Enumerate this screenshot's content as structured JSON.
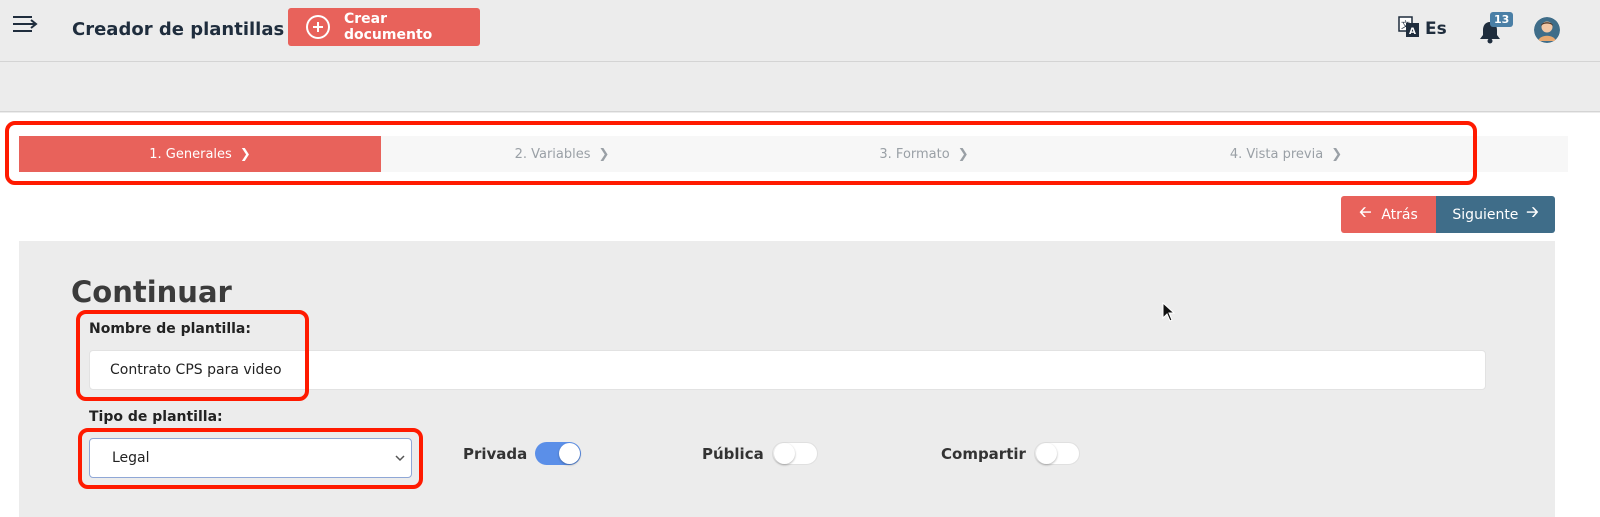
{
  "header": {
    "title": "Creador de plantillas",
    "create_button_label": "Crear documento",
    "language_label": "Es",
    "notification_count": "13"
  },
  "steps": [
    {
      "label": "1. Generales",
      "active": true
    },
    {
      "label": "2. Variables",
      "active": false
    },
    {
      "label": "3. Formato",
      "active": false
    },
    {
      "label": "4. Vista previa",
      "active": false
    }
  ],
  "nav": {
    "back_label": "Atrás",
    "next_label": "Siguiente"
  },
  "form": {
    "title": "Continuar",
    "name_label": "Nombre de plantilla:",
    "name_value": "Contrato CPS para video",
    "type_label": "Tipo de plantilla:",
    "type_value": "Legal",
    "toggles": [
      {
        "label": "Privada",
        "on": true
      },
      {
        "label": "Pública",
        "on": false
      },
      {
        "label": "Compartir",
        "on": false
      }
    ]
  },
  "colors": {
    "accent": "#e8625b",
    "secondary": "#3f6d89",
    "toggle_on": "#5b8fe8",
    "highlight": "#ff1a00"
  }
}
